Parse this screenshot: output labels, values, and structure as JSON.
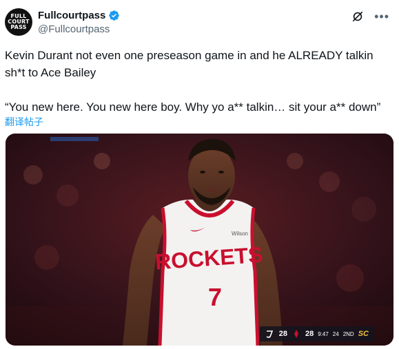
{
  "account": {
    "display_name": "Fullcourtpass",
    "handle": "@Fullcourtpass",
    "avatar_lines": [
      "FULL",
      "COURT",
      "PASS"
    ],
    "verified": true,
    "accent_color": "#1d9bf0"
  },
  "tweet": {
    "text": "Kevin Durant not even one preseason game in and he ALREADY talkin sh*t to Ace Bailey\n\n“You new here. You new here boy. Why yo a** talkin… sit your a** down”",
    "translate_link": "翻译帖子"
  },
  "media": {
    "jersey_text": "ROCKETS",
    "jersey_number": "7",
    "jersey_brand": "Wilson",
    "scorebug": {
      "away_score": "28",
      "home_score": "28",
      "clock": "9:47",
      "shot_clock": "24",
      "period": "2ND",
      "network": "SC"
    }
  },
  "icons": {
    "verified": "verified-badge-icon",
    "grok": "grok-icon",
    "more": "more-options-icon"
  }
}
